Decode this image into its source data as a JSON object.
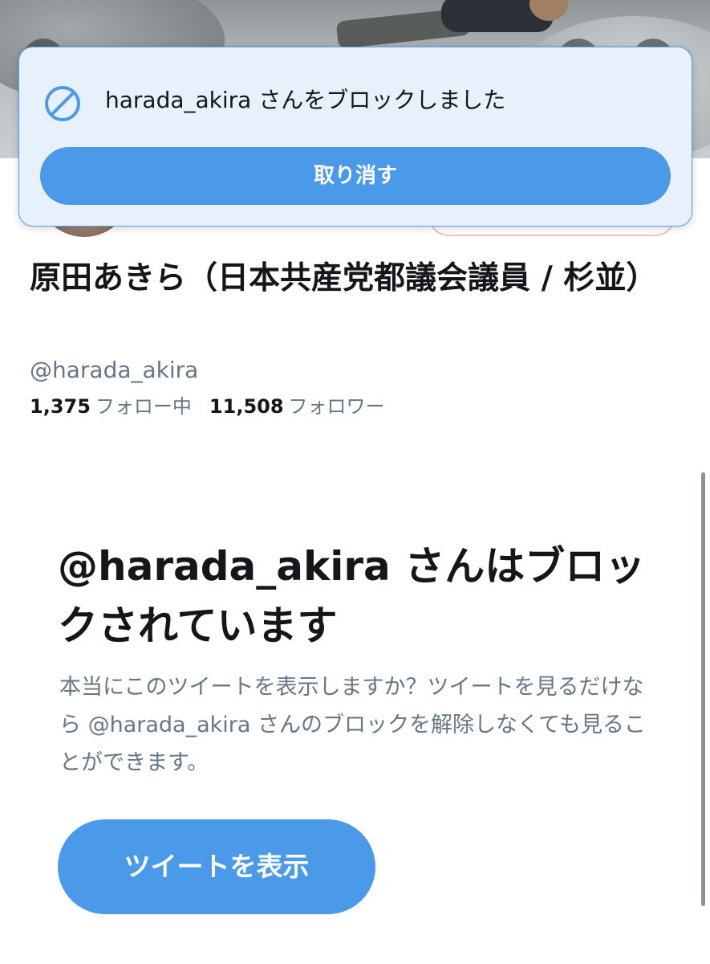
{
  "toast": {
    "message": "harada_akira さんをブロックしました",
    "undo_label": "取り消す",
    "icon": "block-icon"
  },
  "profile": {
    "display_name": "原田あきら（日本共産党都議会議員 / 杉並）",
    "handle": "@harada_akira",
    "following_count": "1,375",
    "following_label": "フォロー中",
    "followers_count": "11,508",
    "followers_label": "フォロワー"
  },
  "blocked": {
    "heading": "@harada_akira さんはブロックされています",
    "body": "本当にこのツイートを表示しますか？ツイートを見るだけなら @harada_akira さんのブロックを解除しなくても見ることができます。",
    "view_button_label": "ツイートを表示"
  },
  "colors": {
    "accent": "#4b99e9",
    "toast_bg": "#e6f1fb",
    "secondary_text": "#657786"
  }
}
